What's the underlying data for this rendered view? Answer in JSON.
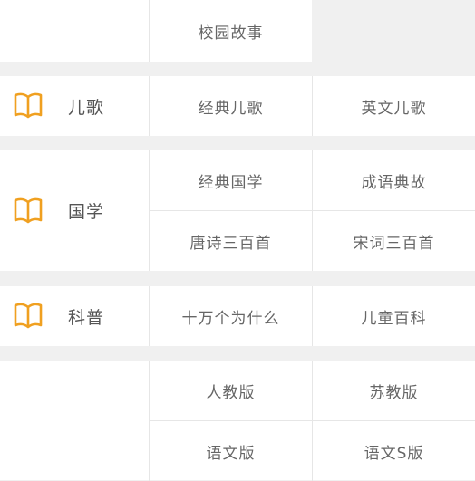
{
  "sections": [
    {
      "id": "top",
      "label": "",
      "items": [
        "校园故事"
      ]
    },
    {
      "id": "erge",
      "label": "儿歌",
      "icon": "book-icon",
      "items": [
        "经典儿歌",
        "英文儿歌"
      ]
    },
    {
      "id": "guoxue",
      "label": "国学",
      "icon": "book-icon",
      "items": [
        "经典国学",
        "成语典故",
        "唐诗三百首",
        "宋词三百首"
      ]
    },
    {
      "id": "kepu",
      "label": "科普",
      "icon": "book-icon",
      "items": [
        "十万个为什么",
        "儿童百科"
      ]
    },
    {
      "id": "jiaocai",
      "label": "",
      "items": [
        "人教版",
        "苏教版",
        "语文版",
        "语文S版"
      ]
    }
  ],
  "colors": {
    "icon": "#f0a020",
    "text": "#666666",
    "label": "#555555",
    "divider": "#e6e6e6",
    "background": "#f0f0f0"
  }
}
